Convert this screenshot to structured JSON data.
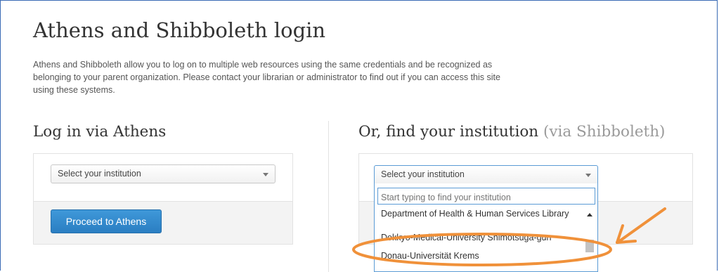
{
  "page": {
    "title": "Athens and Shibboleth login",
    "intro": "Athens and Shibboleth allow you to log on to multiple web resources using the same credentials and be recognized as belonging to your parent organization. Please contact your librarian or administrator to find out if you can access this site using these systems."
  },
  "athens": {
    "heading": "Log in via Athens",
    "select_value": "Select your institution",
    "button_label": "Proceed to Athens"
  },
  "shibboleth": {
    "heading": "Or, find your institution",
    "heading_suffix": "(via Shibboleth)",
    "select_value": "Select your institution",
    "search_placeholder": "Start typing to find your institution",
    "options": [
      "Department of Health & Human Services Library",
      "Dokkyo-Medical-University Shimotsuga-gun",
      "Donau-Universität Krems"
    ]
  },
  "colors": {
    "frame_border": "#3b6bb5",
    "primary_button": "#2a7ec2",
    "focus_border": "#5b9bd5",
    "annotation": "#f0913a"
  },
  "icons": [
    "chevron-down-icon",
    "scroll-up-icon",
    "annotation-arrow-icon"
  ]
}
